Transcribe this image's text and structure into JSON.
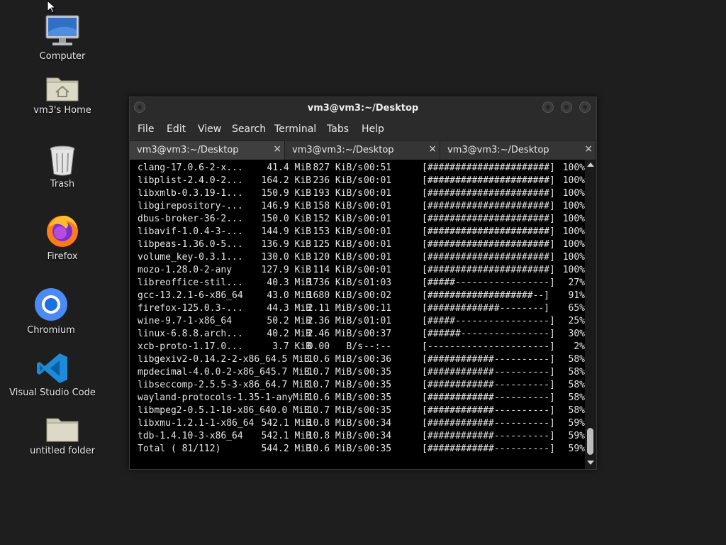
{
  "desktop": {
    "icons": [
      {
        "label": "Computer",
        "icon": "computer-icon"
      },
      {
        "label": "vm3's Home",
        "icon": "home-folder-icon"
      },
      {
        "label": "Trash",
        "icon": "trash-icon"
      },
      {
        "label": "Firefox",
        "icon": "firefox-icon"
      },
      {
        "label": "Chromium",
        "icon": "chromium-icon"
      },
      {
        "label": "Visual Studio Code",
        "icon": "vscode-icon"
      },
      {
        "label": "untitled folder",
        "icon": "folder-icon"
      }
    ]
  },
  "window": {
    "title": "vm3@vm3:~/Desktop",
    "menu": [
      "File",
      "Edit",
      "View",
      "Search",
      "Terminal",
      "Tabs",
      "Help"
    ],
    "tabs": [
      {
        "label": "vm3@vm3:~/Desktop",
        "close": "×"
      },
      {
        "label": "vm3@vm3:~/Desktop",
        "close": "×"
      },
      {
        "label": "vm3@vm3:~/Desktop",
        "close": "×"
      }
    ]
  },
  "terminal": {
    "rows": [
      {
        "name": "clang-17.0.6-2-x...",
        "size": "41.4 MiB",
        "speed": "827 KiB/s",
        "time": "00:51",
        "bar": "[######################]",
        "pct": "100%"
      },
      {
        "name": "libplist-2.4.0-2...",
        "size": "164.2 KiB",
        "speed": "236 KiB/s",
        "time": "00:01",
        "bar": "[######################]",
        "pct": "100%"
      },
      {
        "name": "libxmlb-0.3.19-1...",
        "size": "150.9 KiB",
        "speed": "193 KiB/s",
        "time": "00:01",
        "bar": "[######################]",
        "pct": "100%"
      },
      {
        "name": "libgirepository-...",
        "size": "146.9 KiB",
        "speed": "158 KiB/s",
        "time": "00:01",
        "bar": "[######################]",
        "pct": "100%"
      },
      {
        "name": "dbus-broker-36-2...",
        "size": "150.0 KiB",
        "speed": "152 KiB/s",
        "time": "00:01",
        "bar": "[######################]",
        "pct": "100%"
      },
      {
        "name": "libavif-1.0.4-3-...",
        "size": "144.9 KiB",
        "speed": "153 KiB/s",
        "time": "00:01",
        "bar": "[######################]",
        "pct": "100%"
      },
      {
        "name": "libpeas-1.36.0-5...",
        "size": "136.9 KiB",
        "speed": "125 KiB/s",
        "time": "00:01",
        "bar": "[######################]",
        "pct": "100%"
      },
      {
        "name": "volume_key-0.3.1...",
        "size": "130.0 KiB",
        "speed": "120 KiB/s",
        "time": "00:01",
        "bar": "[######################]",
        "pct": "100%"
      },
      {
        "name": "mozo-1.28.0-2-any",
        "size": "127.9 KiB",
        "speed": "114 KiB/s",
        "time": "00:01",
        "bar": "[######################]",
        "pct": "100%"
      },
      {
        "name": "libreoffice-stil...",
        "size": "40.3 MiB",
        "speed": "1736 KiB/s",
        "time": "01:03",
        "bar": "[#####-----------------]",
        "pct": "27%"
      },
      {
        "name": "gcc-13.2.1-6-x86_64",
        "size": "43.0 MiB",
        "speed": "1680 KiB/s",
        "time": "00:02",
        "bar": "[###################--]",
        "pct": "91%"
      },
      {
        "name": "firefox-125.0.3-...",
        "size": "44.3 MiB",
        "speed": "2.11 MiB/s",
        "time": "00:11",
        "bar": "[#############--------]",
        "pct": "65%"
      },
      {
        "name": "wine-9.7-1-x86_64",
        "size": "50.2 MiB",
        "speed": "2.36 MiB/s",
        "time": "01:01",
        "bar": "[#####-----------------]",
        "pct": "25%"
      },
      {
        "name": "linux-6.8.8.arch...",
        "size": "40.2 MiB",
        "speed": "2.46 MiB/s",
        "time": "00:37",
        "bar": "[######----------------]",
        "pct": "30%"
      },
      {
        "name": "xcb-proto-1.17.0...",
        "size": "3.7 KiB",
        "speed": "0.00   B/s",
        "time": "--:--",
        "bar": "[----------------------]",
        "pct": "2%"
      },
      {
        "name": "libgexiv2-0.14.2-2-x86_64.5 MiB",
        "size": "",
        "speed": "10.6 MiB/s",
        "time": "00:36",
        "bar": "[############----------]",
        "pct": "58%"
      },
      {
        "name": "mpdecimal-4.0.0-2-x86_645.7 MiB",
        "size": "",
        "speed": "10.7 MiB/s",
        "time": "00:35",
        "bar": "[############----------]",
        "pct": "58%"
      },
      {
        "name": "libseccomp-2.5.5-3-x86_64.7 MiB",
        "size": "",
        "speed": "10.7 MiB/s",
        "time": "00:35",
        "bar": "[############----------]",
        "pct": "58%"
      },
      {
        "name": "wayland-protocols-1.35-1-anyMiB",
        "size": "",
        "speed": "10.6 MiB/s",
        "time": "00:35",
        "bar": "[############----------]",
        "pct": "58%"
      },
      {
        "name": "libmpeg2-0.5.1-10-x86_640.0 MiB",
        "size": "",
        "speed": "10.7 MiB/s",
        "time": "00:35",
        "bar": "[############----------]",
        "pct": "58%"
      },
      {
        "name": "libxmu-1.2.1-1-x86_64",
        "size": "542.1 MiB",
        "speed": "10.8 MiB/s",
        "time": "00:34",
        "bar": "[############----------]",
        "pct": "59%"
      },
      {
        "name": "tdb-1.4.10-3-x86_64",
        "size": "542.1 MiB",
        "speed": "10.8 MiB/s",
        "time": "00:34",
        "bar": "[############----------]",
        "pct": "59%"
      },
      {
        "name": "Total ( 81/112)",
        "size": "544.2 MiB",
        "speed": "10.6 MiB/s",
        "time": "00:35",
        "bar": "[############----------]",
        "pct": "59%"
      }
    ]
  }
}
